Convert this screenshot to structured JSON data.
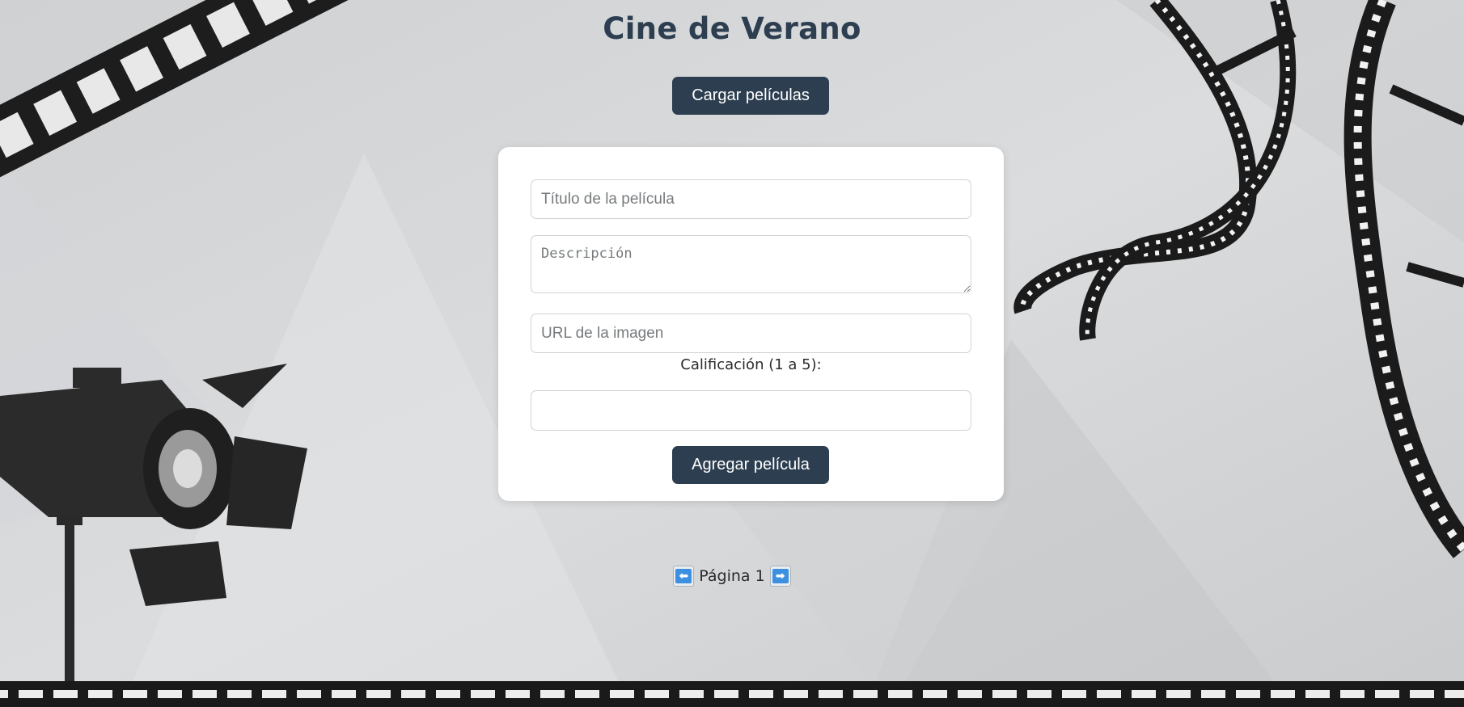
{
  "page": {
    "title": "Cine de Verano",
    "load_button_label": "Cargar películas"
  },
  "form": {
    "title_placeholder": "Título de la película",
    "description_placeholder": "Descripción",
    "image_url_placeholder": "URL de la imagen",
    "rating_label": "Calificación (1 a 5):",
    "rating_value": "",
    "submit_label": "Agregar película"
  },
  "pagination": {
    "prev_icon": "⬅",
    "page_label": "Página 1",
    "next_icon": "➡"
  },
  "colors": {
    "primary": "#2c3e50",
    "card_background": "#ffffff",
    "page_background": "#d6d8da",
    "arrow_accent": "#3d8fe0"
  },
  "icons": {
    "background_decorations": [
      "film-strip",
      "stage-spotlight",
      "film-reel-ribbon"
    ]
  }
}
